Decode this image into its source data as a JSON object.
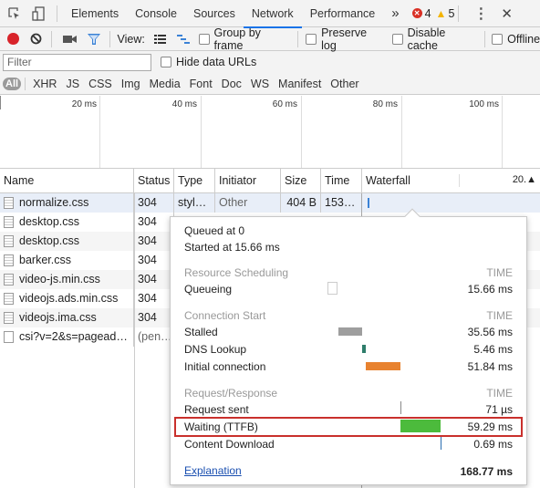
{
  "tabs": {
    "items": [
      "Elements",
      "Console",
      "Sources",
      "Network",
      "Performance"
    ],
    "active": "Network",
    "overflow": "»",
    "errors": "4",
    "warnings": "5",
    "error_color": "#d93025",
    "warning_color": "#f4b400"
  },
  "toolbar": {
    "view_label": "View:",
    "group_by_frame": "Group by frame",
    "preserve_log": "Preserve log",
    "disable_cache": "Disable cache",
    "offline": "Offline"
  },
  "filter": {
    "placeholder": "Filter",
    "hide_data_urls": "Hide data URLs",
    "types": [
      "All",
      "XHR",
      "JS",
      "CSS",
      "Img",
      "Media",
      "Font",
      "Doc",
      "WS",
      "Manifest",
      "Other"
    ]
  },
  "overview": {
    "ticks": [
      "20 ms",
      "40 ms",
      "60 ms",
      "80 ms",
      "100 ms"
    ]
  },
  "table": {
    "headers": {
      "name": "Name",
      "status": "Status",
      "type": "Type",
      "initiator": "Initiator",
      "size": "Size",
      "time": "Time",
      "waterfall": "Waterfall",
      "waterfall_sort": "20.▲"
    },
    "rows": [
      {
        "name": "normalize.css",
        "status": "304",
        "type": "styl…",
        "initiator": "Other",
        "size": "404 B",
        "time": "153…"
      },
      {
        "name": "desktop.css",
        "status": "304"
      },
      {
        "name": "desktop.css",
        "status": "304"
      },
      {
        "name": "barker.css",
        "status": "304"
      },
      {
        "name": "video-js.min.css",
        "status": "304"
      },
      {
        "name": "videojs.ads.min.css",
        "status": "304"
      },
      {
        "name": "videojs.ima.css",
        "status": "304"
      },
      {
        "name": "csi?v=2&s=pagead…",
        "status": "(pen…"
      }
    ]
  },
  "timing": {
    "queued_at": "Queued at 0",
    "started_at": "Started at 15.66 ms",
    "time_label": "TIME",
    "sections": [
      {
        "title": "Resource Scheduling",
        "items": [
          {
            "label": "Queueing",
            "value": "15.66 ms",
            "color": "#ffffff"
          }
        ]
      },
      {
        "title": "Connection Start",
        "items": [
          {
            "label": "Stalled",
            "value": "35.56 ms",
            "color": "#9e9e9e"
          },
          {
            "label": "DNS Lookup",
            "value": "5.46 ms",
            "color": "#2e7d6b"
          },
          {
            "label": "Initial connection",
            "value": "51.84 ms",
            "color": "#e8822f"
          }
        ]
      },
      {
        "title": "Request/Response",
        "items": [
          {
            "label": "Request sent",
            "value": "71 µs",
            "color": "#888888"
          },
          {
            "label": "Waiting (TTFB)",
            "value": "59.29 ms",
            "color": "#4cbb3c",
            "highlighted": true
          },
          {
            "label": "Content Download",
            "value": "0.69 ms",
            "color": "#2a6db0"
          }
        ]
      }
    ],
    "explanation": "Explanation",
    "total": "168.77 ms"
  }
}
